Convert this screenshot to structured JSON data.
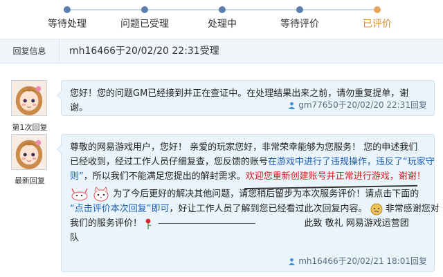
{
  "progress": {
    "steps": [
      "等待处理",
      "问题已受理",
      "处理中",
      "等待评价",
      "已评价"
    ]
  },
  "info_bar": {
    "label": "回复信息",
    "meta": "mh16466于20/02/20 22:31受理"
  },
  "replies": [
    {
      "avatar_label": "第1次回复",
      "text": "您好！您的问题GM已经接到并正在查证中。在处理结果出来之前，请勿重复提单，谢谢。",
      "signature": "gm77650于20/02/20 22:31回复"
    },
    {
      "avatar_label": "最新回复",
      "line1": "尊敬的网易游戏用户，您好！   亲爱的玩家您好，非常荣幸能够为您服务！   您的申述我们",
      "line2_a": "已经收到，经过工作人员仔细复查，您反馈的账号",
      "line2_b": "在游戏中进行了违规操作，违反了",
      "line2_c": "“玩家守",
      "line3_a": "则”",
      "line3_b": "，所以我们不能满足您提出的解封需求。",
      "line3_c": "欢迎您重新创建账号并正常进行游戏，谢谢！",
      "line4": "为了今后更好的解决其他问题，请您稍后留步为本次服务评价！请点击下面的",
      "line5_a": "“点击评价本次回复”即可",
      "line5_b": "，好让工作人员了解到您已经看过此次回复内容。",
      "line5_c": "非常感谢您对",
      "line6_a": "我们的服务评价！",
      "line6_b": "此致   敬礼   网易游戏运营团",
      "line7": "队",
      "signature": "mh16466于20/02/21 18:01回复"
    }
  ],
  "colors": {
    "accent": "#d58b2c",
    "link": "#1f5fb4",
    "warn": "#d21f1f"
  }
}
